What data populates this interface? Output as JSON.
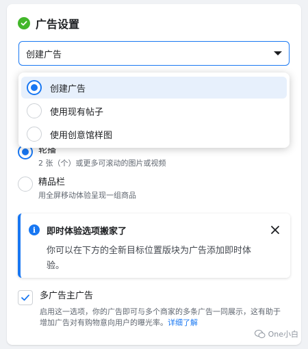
{
  "header": {
    "title": "广告设置"
  },
  "select": {
    "value": "创建广告"
  },
  "menu": {
    "items": [
      {
        "label": "创建广告",
        "selected": true
      },
      {
        "label": "使用现有帖子",
        "selected": false
      },
      {
        "label": "使用创意馆样图",
        "selected": false
      }
    ]
  },
  "formats": {
    "carousel": {
      "name": "轮播",
      "desc": "2 张（个）或更多可滚动的图片或视频"
    },
    "collection": {
      "name": "精品栏",
      "desc": "用全屏移动体验呈现一组商品"
    }
  },
  "notice": {
    "title": "即时体验选项搬家了",
    "body": "你可以在下方的全新目标位置版块为广告添加即时体验。"
  },
  "multi_advertiser": {
    "title": "多广告主广告",
    "desc": "启用这一选项，你的广告即可与多个商家的多条广告一同展示，这有助于增加广告对有购物意向用户的曝光率。",
    "link": "详细了解"
  },
  "watermark": {
    "text": "One小白"
  },
  "colors": {
    "accent": "#1877f2",
    "success": "#42b72a"
  }
}
